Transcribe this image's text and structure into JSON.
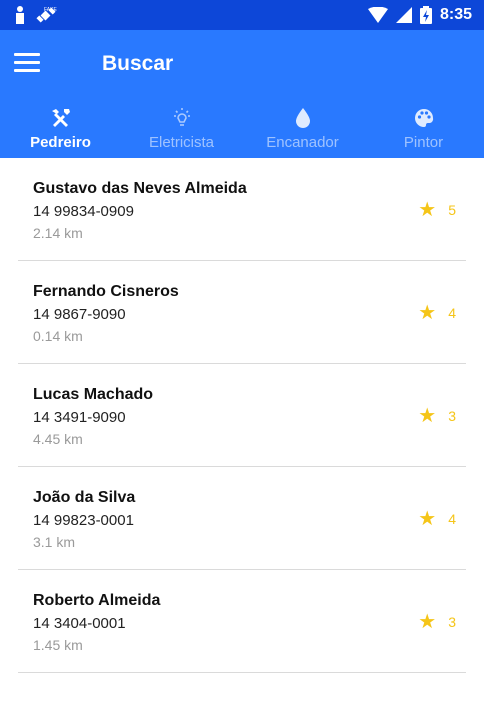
{
  "status_bar": {
    "time": "8:35",
    "icons": [
      "person-icon",
      "satellite-icon",
      "wifi-icon",
      "signal-icon",
      "battery-icon"
    ]
  },
  "app_bar": {
    "title": "Buscar",
    "menu_icon": "hamburger-menu-icon",
    "background": "#2979ff"
  },
  "tabs": [
    {
      "label": "Pedreiro",
      "icon": "tools-icon",
      "active": true
    },
    {
      "label": "Eletricista",
      "icon": "lightbulb-icon",
      "active": false
    },
    {
      "label": "Encanador",
      "icon": "water-drop-icon",
      "active": false
    },
    {
      "label": "Pintor",
      "icon": "palette-icon",
      "active": false
    }
  ],
  "workers": [
    {
      "name": "Gustavo das Neves Almeida",
      "phone": "14 99834-0909",
      "distance": "2.14 km",
      "rating": "5"
    },
    {
      "name": "Fernando Cisneros",
      "phone": "14 9867-9090",
      "distance": "0.14 km",
      "rating": "4"
    },
    {
      "name": "Lucas Machado",
      "phone": "14 3491-9090",
      "distance": "4.45 km",
      "rating": "3"
    },
    {
      "name": "João da Silva",
      "phone": "14 99823-0001",
      "distance": "3.1 km",
      "rating": "4"
    },
    {
      "name": "Roberto Almeida",
      "phone": "14 3404-0001",
      "distance": "1.45 km",
      "rating": "3"
    }
  ],
  "colors": {
    "status_bar": "#0d47d8",
    "primary": "#2979ff",
    "star": "#f5c518",
    "divider": "#dadada"
  }
}
